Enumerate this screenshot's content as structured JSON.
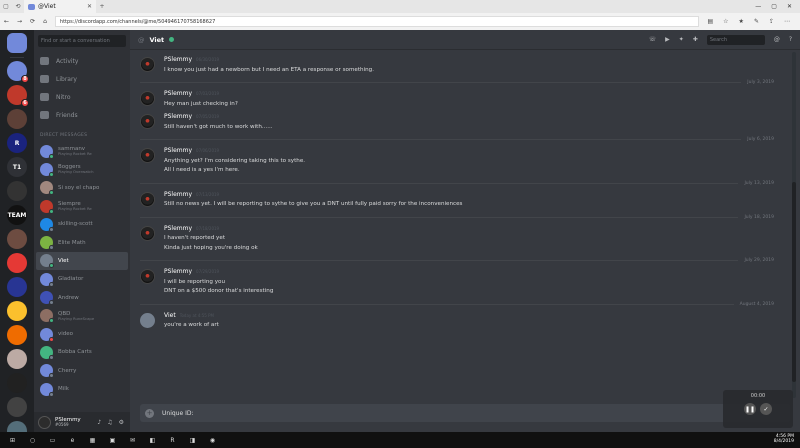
{
  "browser": {
    "tab_title": "@Viet",
    "url": "https://discordapp.com/channels/@me/504946170758168627"
  },
  "guilds": [
    {
      "label": "",
      "color": "#7289da",
      "home": true
    },
    {
      "label": "",
      "color": "#7289da",
      "badge": "8"
    },
    {
      "label": "",
      "color": "#c0392b",
      "badge": "6"
    },
    {
      "label": "",
      "color": "#5d4037"
    },
    {
      "label": "R",
      "color": "#1a237e"
    },
    {
      "label": "T1",
      "color": "#2f3136"
    },
    {
      "label": "",
      "color": "#333"
    },
    {
      "label": "TEAM",
      "color": "#111"
    },
    {
      "label": "",
      "color": "#6d4c41"
    },
    {
      "label": "",
      "color": "#e53935"
    },
    {
      "label": "",
      "color": "#283593"
    },
    {
      "label": "",
      "color": "#fbc02d"
    },
    {
      "label": "",
      "color": "#ef6c00"
    },
    {
      "label": "",
      "color": "#bcaaa4"
    },
    {
      "label": "",
      "color": "#212121"
    },
    {
      "label": "",
      "color": "#424242"
    },
    {
      "label": "",
      "color": "#546e7a"
    },
    {
      "label": "",
      "color": "#8d6e63"
    }
  ],
  "sidebar": {
    "search_placeholder": "Find or start a conversation",
    "nav": [
      {
        "label": "Activity",
        "icon": "activity-icon"
      },
      {
        "label": "Library",
        "icon": "library-icon"
      },
      {
        "label": "Nitro",
        "icon": "nitro-icon"
      },
      {
        "label": "Friends",
        "icon": "friends-icon"
      }
    ],
    "dm_header": "DIRECT MESSAGES",
    "dms": [
      {
        "name": "sammanv",
        "sub": "Playing Rocket Re",
        "color": "#7289da",
        "status": "#43b581"
      },
      {
        "name": "Boggers",
        "sub": "Playing Overwatch",
        "color": "#7289da",
        "status": "#43b581"
      },
      {
        "name": "Si soy el chapo",
        "sub": "",
        "color": "#a1887f",
        "status": "#43b581"
      },
      {
        "name": "Siempre",
        "sub": "Playing Rocket Re",
        "color": "#c0392b",
        "status": "#43b581"
      },
      {
        "name": "skilling-scott",
        "sub": "",
        "color": "#1e88e5",
        "status": "#747f8d"
      },
      {
        "name": "Elite Math",
        "sub": "",
        "color": "#7cb342",
        "status": "#747f8d"
      },
      {
        "name": "Viet",
        "sub": "",
        "color": "#747f8d",
        "status": "#43b581",
        "active": true
      },
      {
        "name": "Gladiator",
        "sub": "",
        "color": "#7289da",
        "status": "#747f8d"
      },
      {
        "name": "Andrew",
        "sub": "",
        "color": "#3f51b5",
        "status": "#747f8d"
      },
      {
        "name": "QBD",
        "sub": "Playing RuneScape",
        "color": "#8d6e63",
        "status": "#43b581"
      },
      {
        "name": "video",
        "sub": "",
        "color": "#7289da",
        "status": "#f04747"
      },
      {
        "name": "Bobba Carts",
        "sub": "",
        "color": "#43b581",
        "status": "#747f8d"
      },
      {
        "name": "Cherry",
        "sub": "",
        "color": "#7289da",
        "status": "#747f8d"
      },
      {
        "name": "Milk",
        "sub": "",
        "color": "#7289da",
        "status": "#747f8d"
      }
    ],
    "user": {
      "name": "PSlemmy",
      "tag": "#0569"
    }
  },
  "chat": {
    "recipient": "Viet",
    "search_placeholder": "Search",
    "composer_text": "Unique ID:",
    "entries": [
      {
        "type": "msg",
        "author": "PSlemmy",
        "avatar": "ps",
        "time": "06/30/2019",
        "lines": [
          "I know you just had a newborn but I need an ETA a response or something."
        ]
      },
      {
        "type": "date",
        "text": "July 3, 2019"
      },
      {
        "type": "msg",
        "author": "PSlemmy",
        "avatar": "ps",
        "time": "07/03/2019",
        "lines": [
          "Hey man just checking in?"
        ]
      },
      {
        "type": "msg",
        "author": "PSlemmy",
        "avatar": "ps",
        "time": "07/05/2019",
        "lines": [
          "Still haven't got much to work with......"
        ]
      },
      {
        "type": "date",
        "text": "July 6, 2019"
      },
      {
        "type": "msg",
        "author": "PSlemmy",
        "avatar": "ps",
        "time": "07/06/2019",
        "lines": [
          "Anything yet? I'm considering taking this to sythe.",
          "All I need is a yes I'm here."
        ]
      },
      {
        "type": "date",
        "text": "July 13, 2019"
      },
      {
        "type": "msg",
        "author": "PSlemmy",
        "avatar": "ps",
        "time": "07/13/2019",
        "lines": [
          "Still no news yet. I will be reporting to sythe to give you a DNT until fully paid sorry for the inconveniences"
        ]
      },
      {
        "type": "date",
        "text": "July 18, 2019"
      },
      {
        "type": "msg",
        "author": "PSlemmy",
        "avatar": "ps",
        "time": "07/18/2019",
        "lines": [
          "I haven't reported yet",
          "Kinda just hoping you're doing ok"
        ]
      },
      {
        "type": "date",
        "text": "July 29, 2019"
      },
      {
        "type": "msg",
        "author": "PSlemmy",
        "avatar": "ps",
        "time": "07/29/2019",
        "lines": [
          "I will be reporting you",
          "DNT on a $500 donor that's interesting"
        ]
      },
      {
        "type": "date",
        "text": "August 4, 2019"
      },
      {
        "type": "msg",
        "author": "Viet",
        "avatar": "viet",
        "time": "Today at 4:55 PM",
        "lines": [
          "you're a work of art"
        ]
      }
    ]
  },
  "overlay": {
    "time": "00:00"
  },
  "taskbar": {
    "time": "4:56 PM",
    "date": "8/4/2019"
  }
}
